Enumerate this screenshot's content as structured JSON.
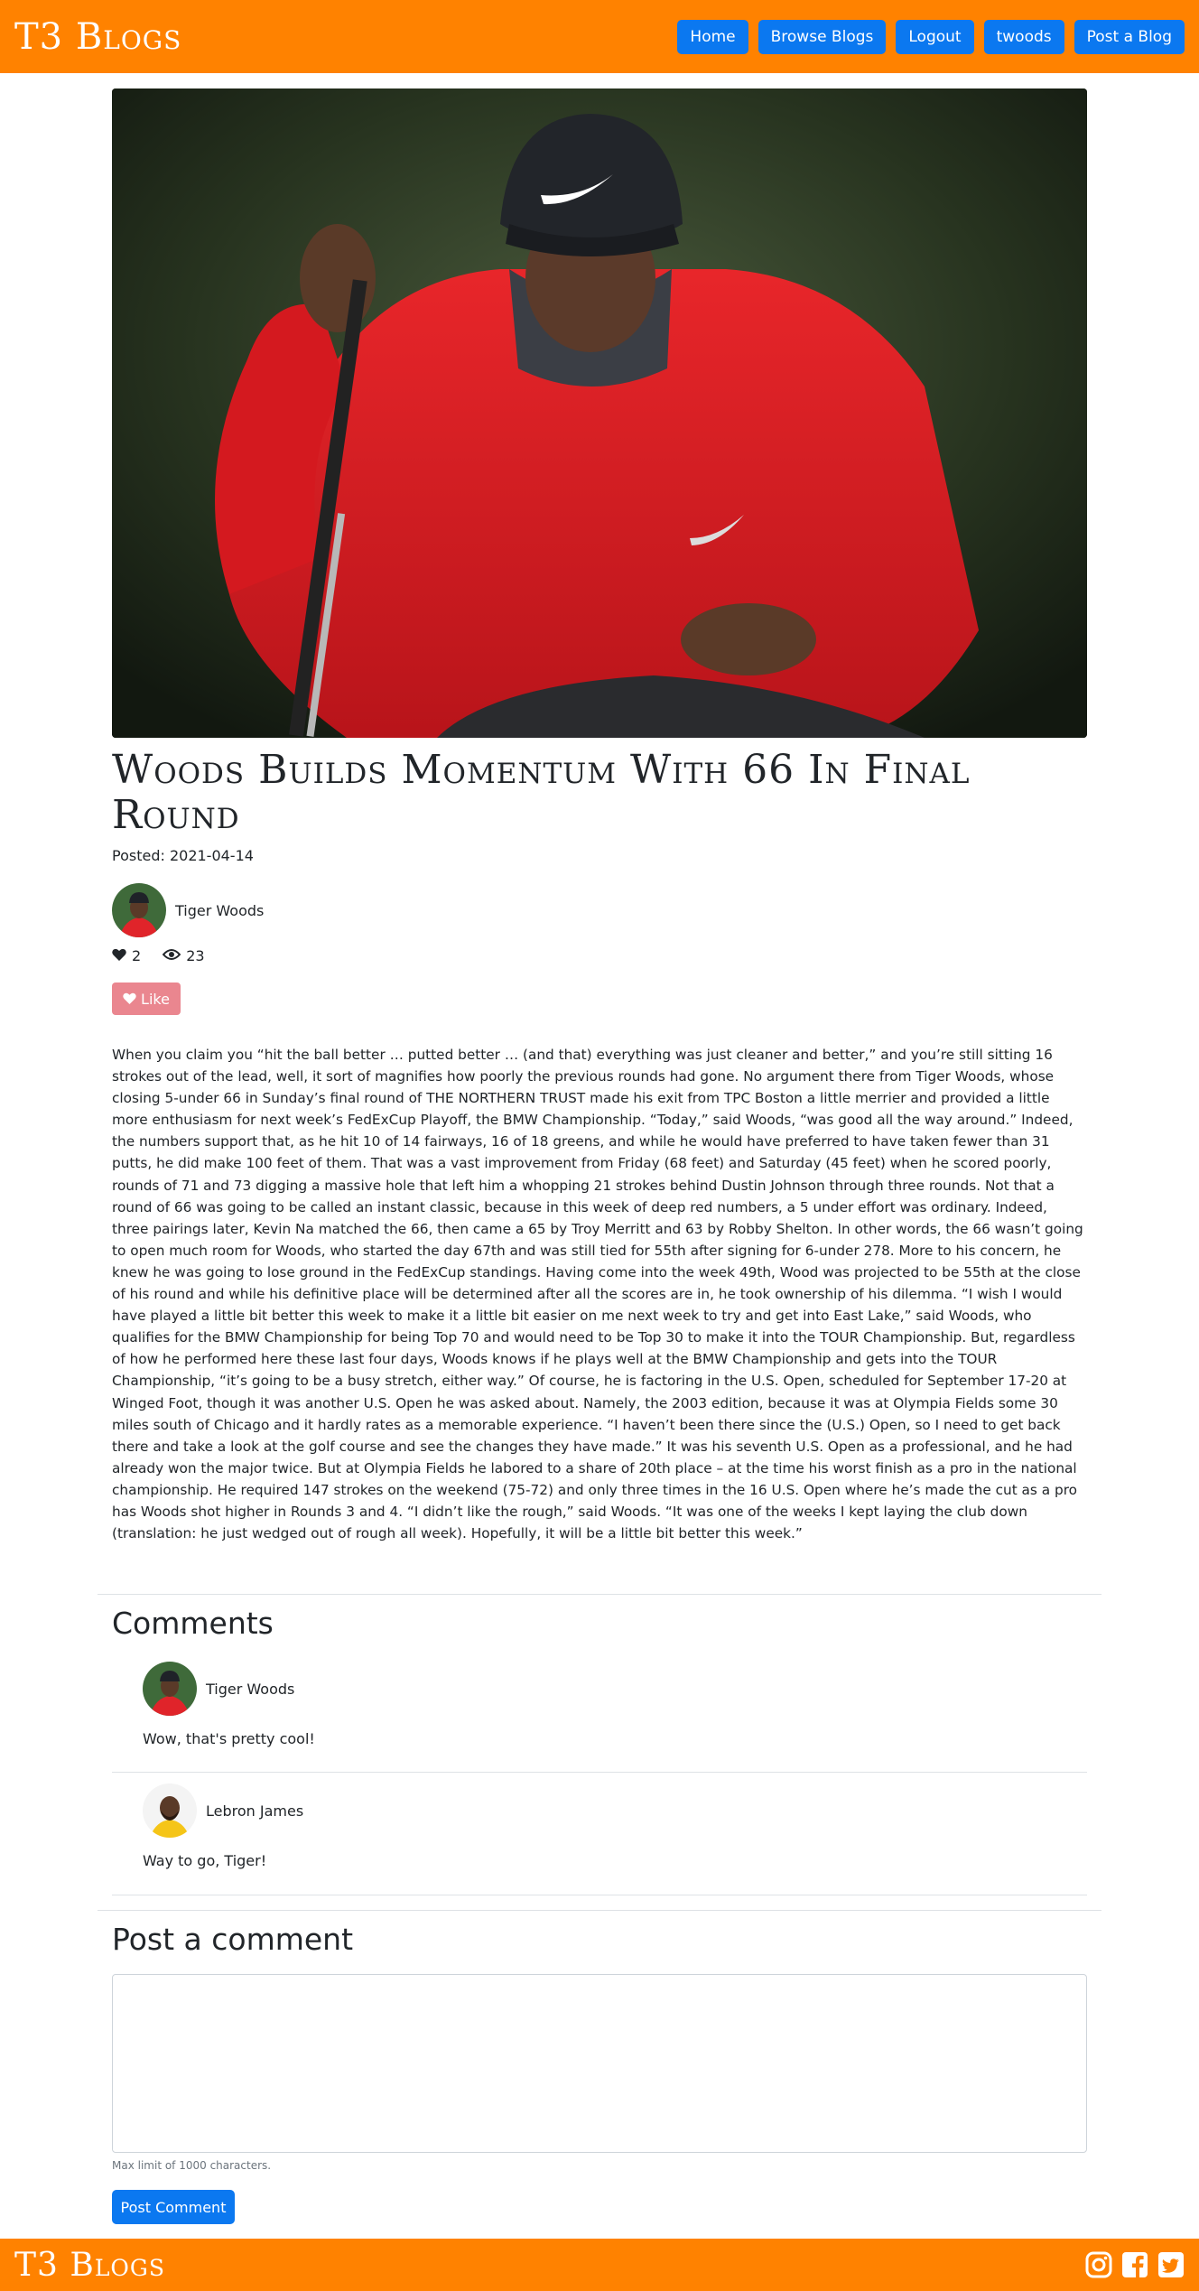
{
  "navbar": {
    "brand": "T3 Blogs",
    "buttons": [
      "Home",
      "Browse Blogs",
      "Logout",
      "twoods",
      "Post a Blog"
    ]
  },
  "post": {
    "title": "Woods Builds Momentum With 66 In Final Round",
    "posted": "Posted: 2021-04-14",
    "author": "Tiger Woods",
    "likes": "2",
    "views": "23",
    "like_label": "Like",
    "body": "When you claim you “hit the ball better … putted better … (and that) everything was just cleaner and better,” and you’re still sitting 16 strokes out of the lead, well, it sort of magnifies how poorly the previous rounds had gone. No argument there from Tiger Woods, whose closing 5-under 66 in Sunday’s final round of THE NORTHERN TRUST made his exit from TPC Boston a little merrier and provided a little more enthusiasm for next week’s FedExCup Playoff, the BMW Championship. “Today,” said Woods, “was good all the way around.” Indeed, the numbers support that, as he hit 10 of 14 fairways, 16 of 18 greens, and while he would have preferred to have taken fewer than 31 putts, he did make 100 feet of them. That was a vast improvement from Friday (68 feet) and Saturday (45 feet) when he scored poorly, rounds of 71 and 73 digging a massive hole that left him a whopping 21 strokes behind Dustin Johnson through three rounds. Not that a round of 66 was going to be called an instant classic, because in this week of deep red numbers, a 5 under effort was ordinary. Indeed, three pairings later, Kevin Na matched the 66, then came a 65 by Troy Merritt and 63 by Robby Shelton. In other words, the 66 wasn’t going to open much room for Woods, who started the day 67th and was still tied for 55th after signing for 6-under 278. More to his concern, he knew he was going to lose ground in the FedExCup standings. Having come into the week 49th, Wood was projected to be 55th at the close of his round and while his definitive place will be determined after all the scores are in, he took ownership of his dilemma. “I wish I would have played a little bit better this week to make it a little bit easier on me next week to try and get into East Lake,” said Woods, who qualifies for the BMW Championship for being Top 70 and would need to be Top 30 to make it into the TOUR Championship. But, regardless of how he performed here these last four days, Woods knows if he plays well at the BMW Championship and gets into the TOUR Championship, “it’s going to be a busy stretch, either way.” Of course, he is factoring in the U.S. Open, scheduled for September 17-20 at Winged Foot, though it was another U.S. Open he was asked about. Namely, the 2003 edition, because it was at Olympia Fields some 30 miles south of Chicago and it hardly rates as a memorable experience. “I haven’t been there since the (U.S.) Open, so I need to get back there and take a look at the golf course and see the changes they have made.” It was his seventh U.S. Open as a professional, and he had already won the major twice. But at Olympia Fields he labored to a share of 20th place – at the time his worst finish as a pro in the national championship. He required 147 strokes on the weekend (75-72) and only three times in the 16 U.S. Open where he’s made the cut as a pro has Woods shot higher in Rounds 3 and 4. “I didn’t like the rough,” said Woods. “It was one of the weeks I kept laying the club down (translation: he just wedged out of rough all week). Hopefully, it will be a little bit better this week.”"
  },
  "comments": {
    "title": "Comments",
    "items": [
      {
        "author": "Tiger Woods",
        "text": "Wow, that's pretty cool!"
      },
      {
        "author": "Lebron James",
        "text": "Way to go, Tiger!"
      }
    ]
  },
  "post_comment": {
    "title": "Post a comment",
    "hint": "Max limit of 1000 characters.",
    "button": "Post Comment"
  },
  "footer": {
    "brand": "T3 Blogs",
    "social": [
      "instagram-icon",
      "facebook-icon",
      "twitter-icon"
    ]
  },
  "colors": {
    "brand_orange": "#ff8200",
    "button_blue": "#0b78f0",
    "like_pink": "#ea868f"
  }
}
